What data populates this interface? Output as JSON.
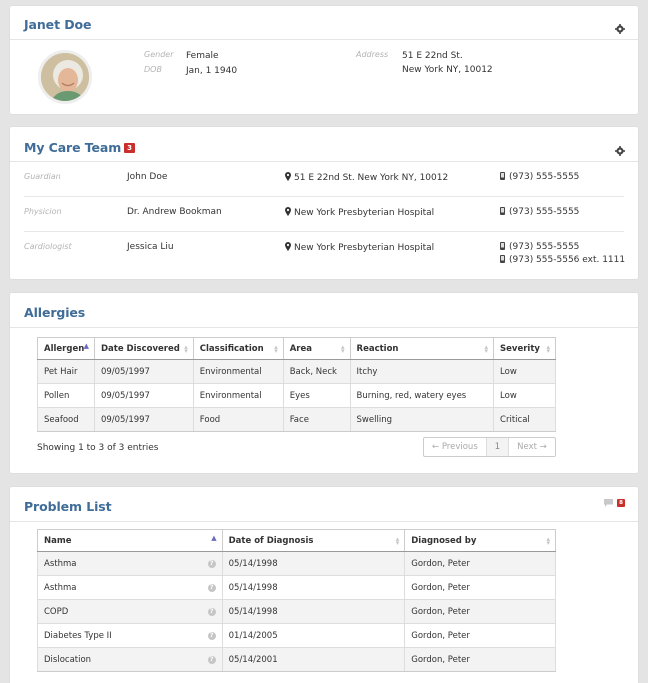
{
  "patient": {
    "name": "Janet Doe",
    "gender_label": "Gender",
    "gender": "Female",
    "dob_label": "DOB",
    "dob": "Jan, 1 1940",
    "address_label": "Address",
    "address_line1": "51 E 22nd St.",
    "address_line2": "New York NY, 10012"
  },
  "care_team": {
    "title": "My Care Team",
    "count": "3",
    "members": [
      {
        "role": "Guardian",
        "name": "John Doe",
        "location": "51 E 22nd St. New York NY, 10012",
        "phones": [
          "(973) 555-5555"
        ]
      },
      {
        "role": "Physicion",
        "name": "Dr. Andrew Bookman",
        "location": "New York Presbyterian Hospital",
        "phones": [
          "(973) 555-5555"
        ]
      },
      {
        "role": "Cardiologist",
        "name": "Jessica Liu",
        "location": "New York Presbyterian Hospital",
        "phones": [
          "(973) 555-5555",
          "(973) 555-5556 ext. 1111"
        ]
      }
    ]
  },
  "allergies": {
    "title": "Allergies",
    "columns": [
      "Allergen",
      "Date Discovered",
      "Classification",
      "Area",
      "Reaction",
      "Severity"
    ],
    "rows": [
      [
        "Pet Hair",
        "09/05/1997",
        "Environmental",
        "Back, Neck",
        "Itchy",
        "Low"
      ],
      [
        "Pollen",
        "09/05/1997",
        "Environmental",
        "Eyes",
        "Burning, red, watery eyes",
        "Low"
      ],
      [
        "Seafood",
        "09/05/1997",
        "Food",
        "Face",
        "Swelling",
        "Critical"
      ]
    ],
    "info": "Showing 1 to 3 of 3 entries",
    "pager": {
      "previous": "← Previous",
      "page": "1",
      "next": "Next →"
    }
  },
  "problems": {
    "title": "Problem List",
    "badge": "8",
    "columns": [
      "Name",
      "Date of Diagnosis",
      "Diagnosed by"
    ],
    "rows": [
      [
        "Asthma",
        "05/14/1998",
        "Gordon, Peter"
      ],
      [
        "Asthma",
        "05/14/1998",
        "Gordon, Peter"
      ],
      [
        "COPD",
        "05/14/1998",
        "Gordon, Peter"
      ],
      [
        "Diabetes Type II",
        "01/14/2005",
        "Gordon, Peter"
      ],
      [
        "Dislocation",
        "05/14/2001",
        "Gordon, Peter"
      ]
    ],
    "help_glyph": "?"
  },
  "colors": {
    "title": "#3f6d98",
    "badge": "#c9302c",
    "background": "#e4e4e4"
  },
  "icons": [
    "gear-icon",
    "map-marker-icon",
    "mobile-phone-icon",
    "comment-icon",
    "question-icon",
    "sort-icon"
  ]
}
